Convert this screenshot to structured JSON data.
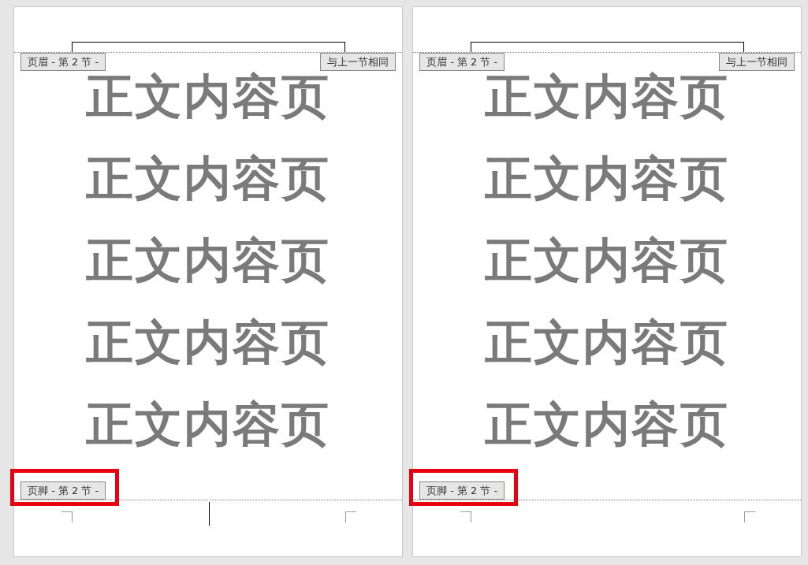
{
  "pages": [
    {
      "header_label": "页眉 - 第 2 节 -",
      "header_link_label": "与上一节相同",
      "body_lines": [
        "正文内容页",
        "正文内容页",
        "正文内容页",
        "正文内容页",
        "正文内容页"
      ],
      "footer_label": "页脚 - 第 2 节 -",
      "footer_highlighted": true,
      "cursor_shown": true
    },
    {
      "header_label": "页眉 - 第 2 节 -",
      "header_link_label": "与上一节相同",
      "body_lines": [
        "正文内容页",
        "正文内容页",
        "正文内容页",
        "正文内容页",
        "正文内容页"
      ],
      "footer_label": "页脚 - 第 2 节 -",
      "footer_highlighted": true,
      "cursor_shown": false
    }
  ]
}
